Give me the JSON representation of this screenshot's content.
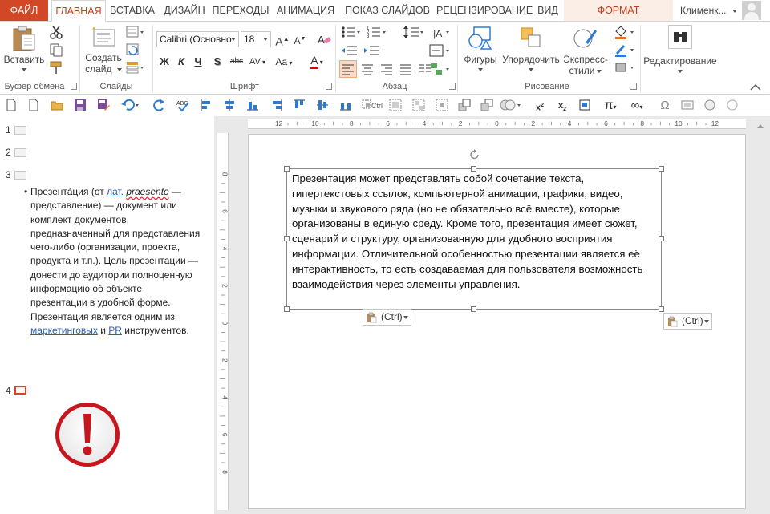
{
  "tabs": [
    {
      "label": "ФАЙЛ"
    },
    {
      "label": "ГЛАВНАЯ"
    },
    {
      "label": "ВСТАВКА"
    },
    {
      "label": "ДИЗАЙН"
    },
    {
      "label": "ПЕРЕХОДЫ"
    },
    {
      "label": "АНИМАЦИЯ"
    },
    {
      "label": "ПОКАЗ СЛАЙДОВ"
    },
    {
      "label": "РЕЦЕНЗИРОВАНИЕ"
    },
    {
      "label": "ВИД"
    },
    {
      "label": "ФОРМАТ"
    }
  ],
  "user": {
    "name": "Клименк..."
  },
  "ribbon": {
    "clipboard": {
      "paste_label": "Вставить",
      "group_label": "Буфер обмена"
    },
    "slides": {
      "create_label_1": "Создать",
      "create_label_2": "слайд",
      "group_label": "Слайды"
    },
    "font": {
      "font_name": "Calibri (Основно",
      "font_size": "18",
      "group_label": "Шрифт",
      "bold": "Ж",
      "italic": "К",
      "underline": "Ч",
      "shadow": "S",
      "strike": "abc",
      "spacing": "AV",
      "case": "Aa",
      "color": "A"
    },
    "paragraph": {
      "group_label": "Абзац"
    },
    "drawing": {
      "shapes_label": "Фигуры",
      "arrange_label": "Упорядочить",
      "quick_styles_label_1": "Экспресс-",
      "quick_styles_label_2": "стили",
      "group_label": "Рисование"
    },
    "editing": {
      "label": "Редактирование"
    }
  },
  "outline": {
    "slides": [
      {
        "num": "1"
      },
      {
        "num": "2"
      },
      {
        "num": "3"
      },
      {
        "num": "4"
      }
    ],
    "bullet": "•",
    "text_parts": {
      "p1": "Презента́ция (от ",
      "lat": "лат.",
      "p2": " ",
      "praesento": "praesento",
      "p3": " — представление) — документ или комплект документов, предназначенный для представления чего-либо (организации, проекта, продукта и т.п.). Цель презентации — донести до аудитории полноценную информацию об объекте презентации в удобной форме. Презентация является одним из ",
      "marketing": "маркетинговых",
      "p4": " и ",
      "pr": "PR",
      "p5": " инструментов."
    }
  },
  "slide": {
    "text": "Презентация может представлять собой сочетание текста, гипертекстовых ссылок, компьютерной анимации, графики, видео, музыки и звукового ряда (но не обязательно всё вместе), которые организованы в единую среду. Кроме того, презентация имеет сюжет, сценарий и структуру, организованную для удобного восприятия информации. Отличительной особенностью презентации является её интерактивность, то есть создаваемая для пользователя возможность взаимодействия через элементы управления.",
    "paste_ctrl_1": "(Ctrl)",
    "paste_ctrl_2": "(Ctrl)"
  },
  "ruler": {
    "h_labels": [
      "12",
      "10",
      "8",
      "6",
      "4",
      "2",
      "0",
      "2",
      "4",
      "6",
      "8",
      "10",
      "12"
    ],
    "v_labels": [
      "8",
      "6",
      "4",
      "2",
      "0",
      "2",
      "4",
      "6",
      "8"
    ]
  },
  "colors": {
    "accent": "#d24726",
    "tab_active_text": "#c43e1c",
    "context_tab_bg": "#fbeee6",
    "link": "#2a5db0",
    "warning_red": "#c8161e"
  }
}
